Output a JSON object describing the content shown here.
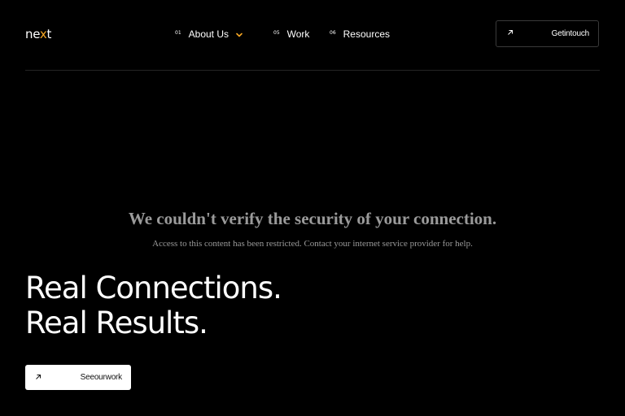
{
  "header": {
    "logo": {
      "text_main": "ne",
      "text_accent": "x",
      "text_end": "t"
    },
    "nav": [
      {
        "num": "01",
        "label": "About Us",
        "has_dropdown": true,
        "dropdown_icon": "chevron-down-icon"
      },
      {
        "num": "05",
        "label": "Work",
        "has_dropdown": false
      },
      {
        "num": "06",
        "label": "Resources",
        "has_dropdown": false
      }
    ],
    "cta": {
      "label": "Getintouch",
      "icon": "arrow-up-right-icon"
    }
  },
  "notice": {
    "title": "We couldn't verify the security of your connection.",
    "subtitle": "Access to this content has been restricted. Contact your internet service provider for help."
  },
  "hero": {
    "line1": "Real Connections.",
    "line2": "Real Results.",
    "cta": {
      "label": "Seeourwork",
      "icon": "arrow-up-right-icon"
    }
  },
  "colors": {
    "background": "#000000",
    "accent": "#f5a623",
    "text": "#ffffff",
    "notice_text": "#9a9a9a"
  }
}
